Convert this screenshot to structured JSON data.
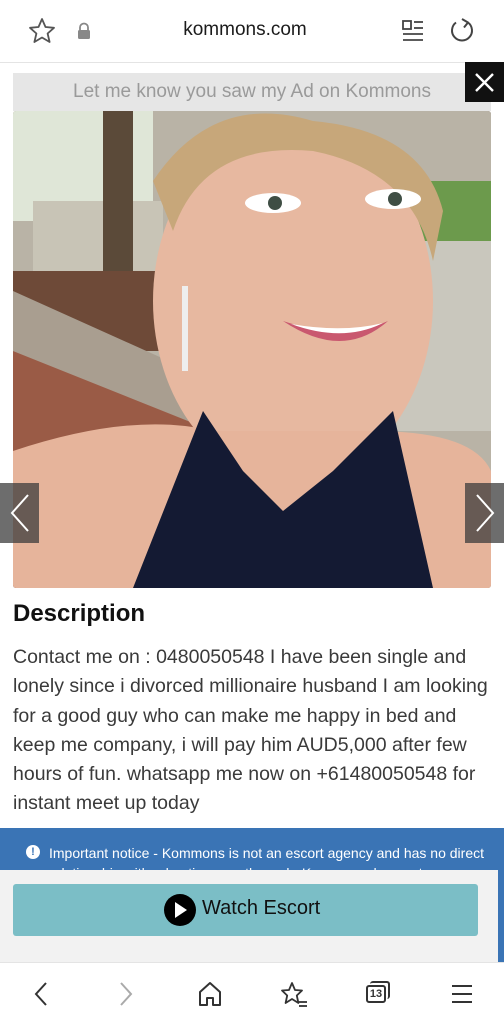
{
  "browser": {
    "url": "kommons.com",
    "icons": [
      "star-icon",
      "lock-icon",
      "reader-mode-icon",
      "reload-icon"
    ]
  },
  "ad": {
    "banner_text": "Let me know you saw my Ad on Kommons",
    "close_icon": "close-icon"
  },
  "gallery": {
    "prev_icon": "chevron-left-icon",
    "next_icon": "chevron-right-icon"
  },
  "description": {
    "title": "Description",
    "body": "Contact me on : 0480050548 I have been single and lonely since i divorced millionaire husband I am looking for a good guy who can make me happy in bed and keep me company, i will pay him AUD5,000 after few hours of fun. whatsapp me now on +61480050548 for instant meet up today"
  },
  "notice": {
    "icon": "!",
    "text": "Important notice - Kommons is not an escort agency and has no direct relationship with advertisers on the web. Kommons does not"
  },
  "watch": {
    "label": "Watch Escort",
    "icon": "play-icon"
  },
  "bottom_nav": {
    "tab_count": "13",
    "icons": [
      "back-icon",
      "forward-icon",
      "home-icon",
      "bookmarks-icon",
      "tabs-icon",
      "menu-icon"
    ]
  },
  "colors": {
    "notice_bg": "#3a74b5",
    "watch_button_bg": "#7bbec6",
    "ad_banner_bg": "#e6e6e6"
  }
}
